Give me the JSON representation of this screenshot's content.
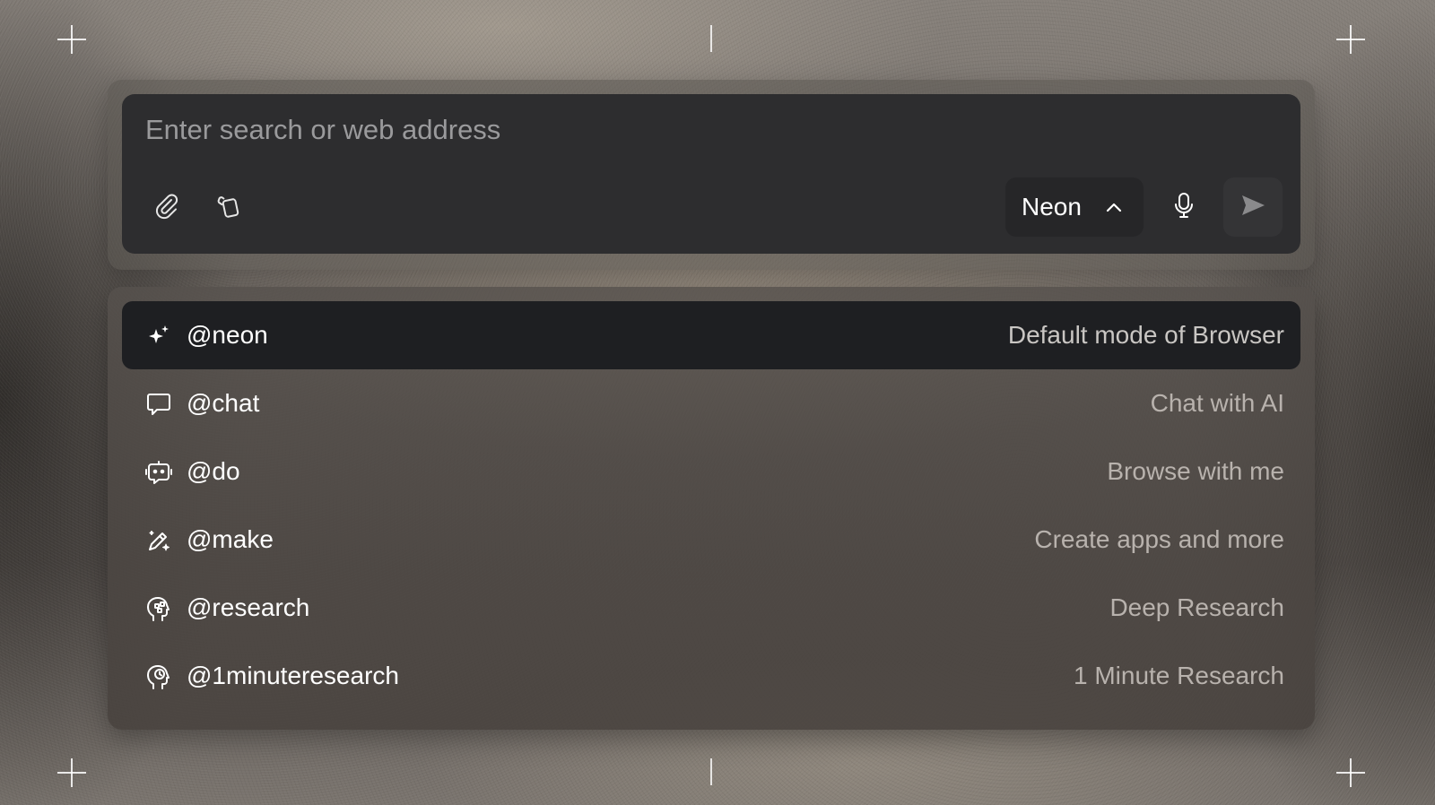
{
  "search": {
    "placeholder": "Enter search or web address",
    "value": "",
    "attach_icon": "paperclip-icon",
    "tabs_icon": "cards-icon"
  },
  "model_selector": {
    "label": "Neon",
    "icon": "chevron-up-icon"
  },
  "mic_icon": "microphone-icon",
  "send_icon": "send-icon",
  "modes": [
    {
      "name": "@neon",
      "description": "Default mode of Browser",
      "icon": "sparkles-icon",
      "active": true
    },
    {
      "name": "@chat",
      "description": "Chat with AI",
      "icon": "chat-bubble-icon",
      "active": false
    },
    {
      "name": "@do",
      "description": "Browse with me",
      "icon": "robot-icon",
      "active": false
    },
    {
      "name": "@make",
      "description": "Create apps and more",
      "icon": "magic-pencil-icon",
      "active": false
    },
    {
      "name": "@research",
      "description": "Deep Research",
      "icon": "research-head-icon",
      "active": false
    },
    {
      "name": "@1minuteresearch",
      "description": "1 Minute Research",
      "icon": "clock-head-icon",
      "active": false
    }
  ],
  "colors": {
    "input_bg": "#2d2d2f",
    "active_row_bg": "#1e1f22",
    "text_primary": "#ffffff",
    "text_secondary": "#b8b2ad"
  }
}
